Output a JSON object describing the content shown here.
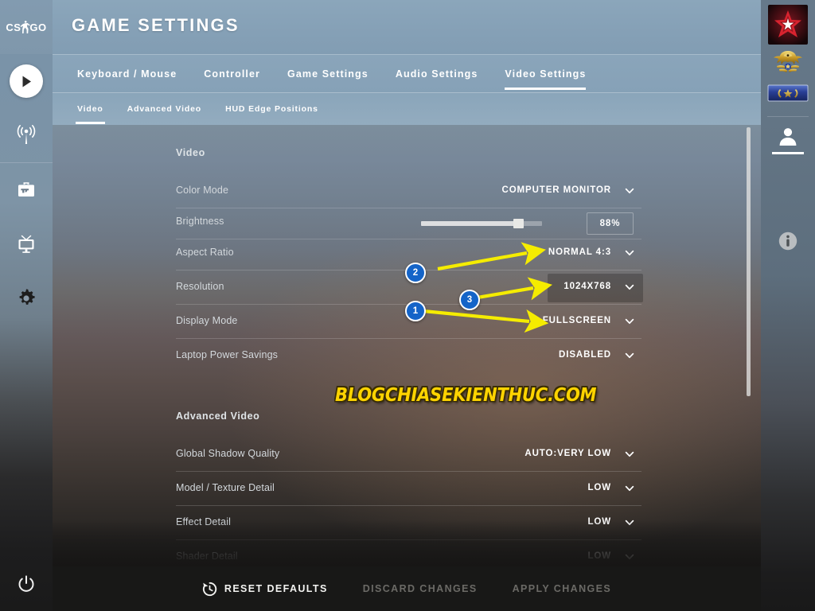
{
  "app": {
    "logo_left": "CS",
    "logo_right": "GO",
    "title": "GAME SETTINGS"
  },
  "sidebar": {
    "items": [
      {
        "icon": "play-icon",
        "name": "play"
      },
      {
        "icon": "broadcast-icon",
        "name": "watch-broadcast"
      },
      {
        "icon": "inventory-icon",
        "name": "inventory"
      },
      {
        "icon": "tv-icon",
        "name": "watch"
      },
      {
        "icon": "gear-icon",
        "name": "settings"
      }
    ],
    "power": {
      "icon": "power-icon",
      "name": "power"
    }
  },
  "tabs": [
    {
      "label": "Keyboard / Mouse",
      "active": false
    },
    {
      "label": "Controller",
      "active": false
    },
    {
      "label": "Game Settings",
      "active": false
    },
    {
      "label": "Audio Settings",
      "active": false
    },
    {
      "label": "Video Settings",
      "active": true
    }
  ],
  "subtabs": [
    {
      "label": "Video",
      "active": true
    },
    {
      "label": "Advanced Video",
      "active": false
    },
    {
      "label": "HUD Edge Positions",
      "active": false
    }
  ],
  "sections": {
    "video": {
      "heading": "Video",
      "rows": [
        {
          "label": "Color Mode",
          "value": "COMPUTER MONITOR",
          "type": "dropdown"
        },
        {
          "label": "Brightness",
          "value": "88%",
          "type": "slider",
          "percent": 80
        },
        {
          "label": "Aspect Ratio",
          "value": "NORMAL 4:3",
          "type": "dropdown"
        },
        {
          "label": "Resolution",
          "value": "1024X768",
          "type": "dropdown",
          "highlighted": true
        },
        {
          "label": "Display Mode",
          "value": "FULLSCREEN",
          "type": "dropdown"
        },
        {
          "label": "Laptop Power Savings",
          "value": "DISABLED",
          "type": "dropdown"
        }
      ]
    },
    "advanced_video": {
      "heading": "Advanced Video",
      "rows": [
        {
          "label": "Global Shadow Quality",
          "value": "AUTO:VERY LOW",
          "type": "dropdown"
        },
        {
          "label": "Model / Texture Detail",
          "value": "LOW",
          "type": "dropdown"
        },
        {
          "label": "Effect Detail",
          "value": "LOW",
          "type": "dropdown"
        },
        {
          "label": "Shader Detail",
          "value": "LOW",
          "type": "dropdown"
        }
      ]
    }
  },
  "annotations": [
    {
      "number": "1",
      "target": "Display Mode value FULLSCREEN"
    },
    {
      "number": "2",
      "target": "Aspect Ratio value NORMAL 4:3"
    },
    {
      "number": "3",
      "target": "Resolution value 1024X768"
    }
  ],
  "watermark": {
    "text": "BLOGCHIASEKIENTHUC.COM",
    "color": "#ffd400"
  },
  "right_panel": {
    "badges": [
      {
        "name": "team-logo-badge"
      },
      {
        "name": "eagle-rank-medal"
      },
      {
        "name": "service-medal"
      }
    ],
    "profile": {
      "icon": "person-icon"
    },
    "info": {
      "icon": "info-icon"
    }
  },
  "bottom_bar": {
    "reset": {
      "label": "RESET DEFAULTS",
      "icon": "revert-clock-icon",
      "enabled": true
    },
    "discard": {
      "label": "DISCARD CHANGES",
      "enabled": false
    },
    "apply": {
      "label": "APPLY CHANGES",
      "enabled": false
    }
  },
  "theme": {
    "accent_blue": "#1464c8",
    "header_blue": "#85a0b6",
    "watermark_yellow": "#ffd400",
    "annotation_yellow": "#f5ec00"
  }
}
